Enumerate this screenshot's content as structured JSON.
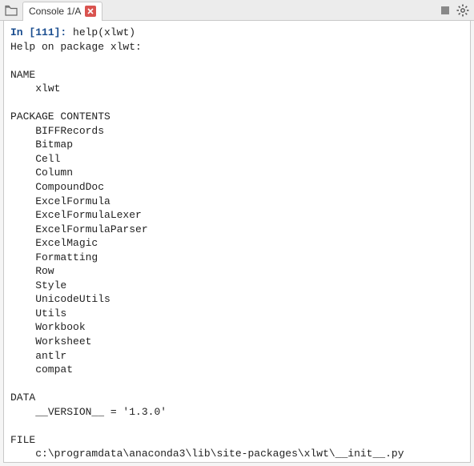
{
  "tabs": {
    "active_label": "Console 1/A"
  },
  "console": {
    "prompt_in": "In [",
    "prompt_num": "111",
    "prompt_close": "]: ",
    "command": "help(xlwt)",
    "help_header": "Help on package xlwt:",
    "section_name": "NAME",
    "name_value": "xlwt",
    "section_contents": "PACKAGE CONTENTS",
    "contents": [
      "BIFFRecords",
      "Bitmap",
      "Cell",
      "Column",
      "CompoundDoc",
      "ExcelFormula",
      "ExcelFormulaLexer",
      "ExcelFormulaParser",
      "ExcelMagic",
      "Formatting",
      "Row",
      "Style",
      "UnicodeUtils",
      "Utils",
      "Workbook",
      "Worksheet",
      "antlr",
      "compat"
    ],
    "section_data": "DATA",
    "data_line": "__VERSION__ = '1.3.0'",
    "section_file": "FILE",
    "file_line": "c:\\programdata\\anaconda3\\lib\\site-packages\\xlwt\\__init__.py"
  }
}
